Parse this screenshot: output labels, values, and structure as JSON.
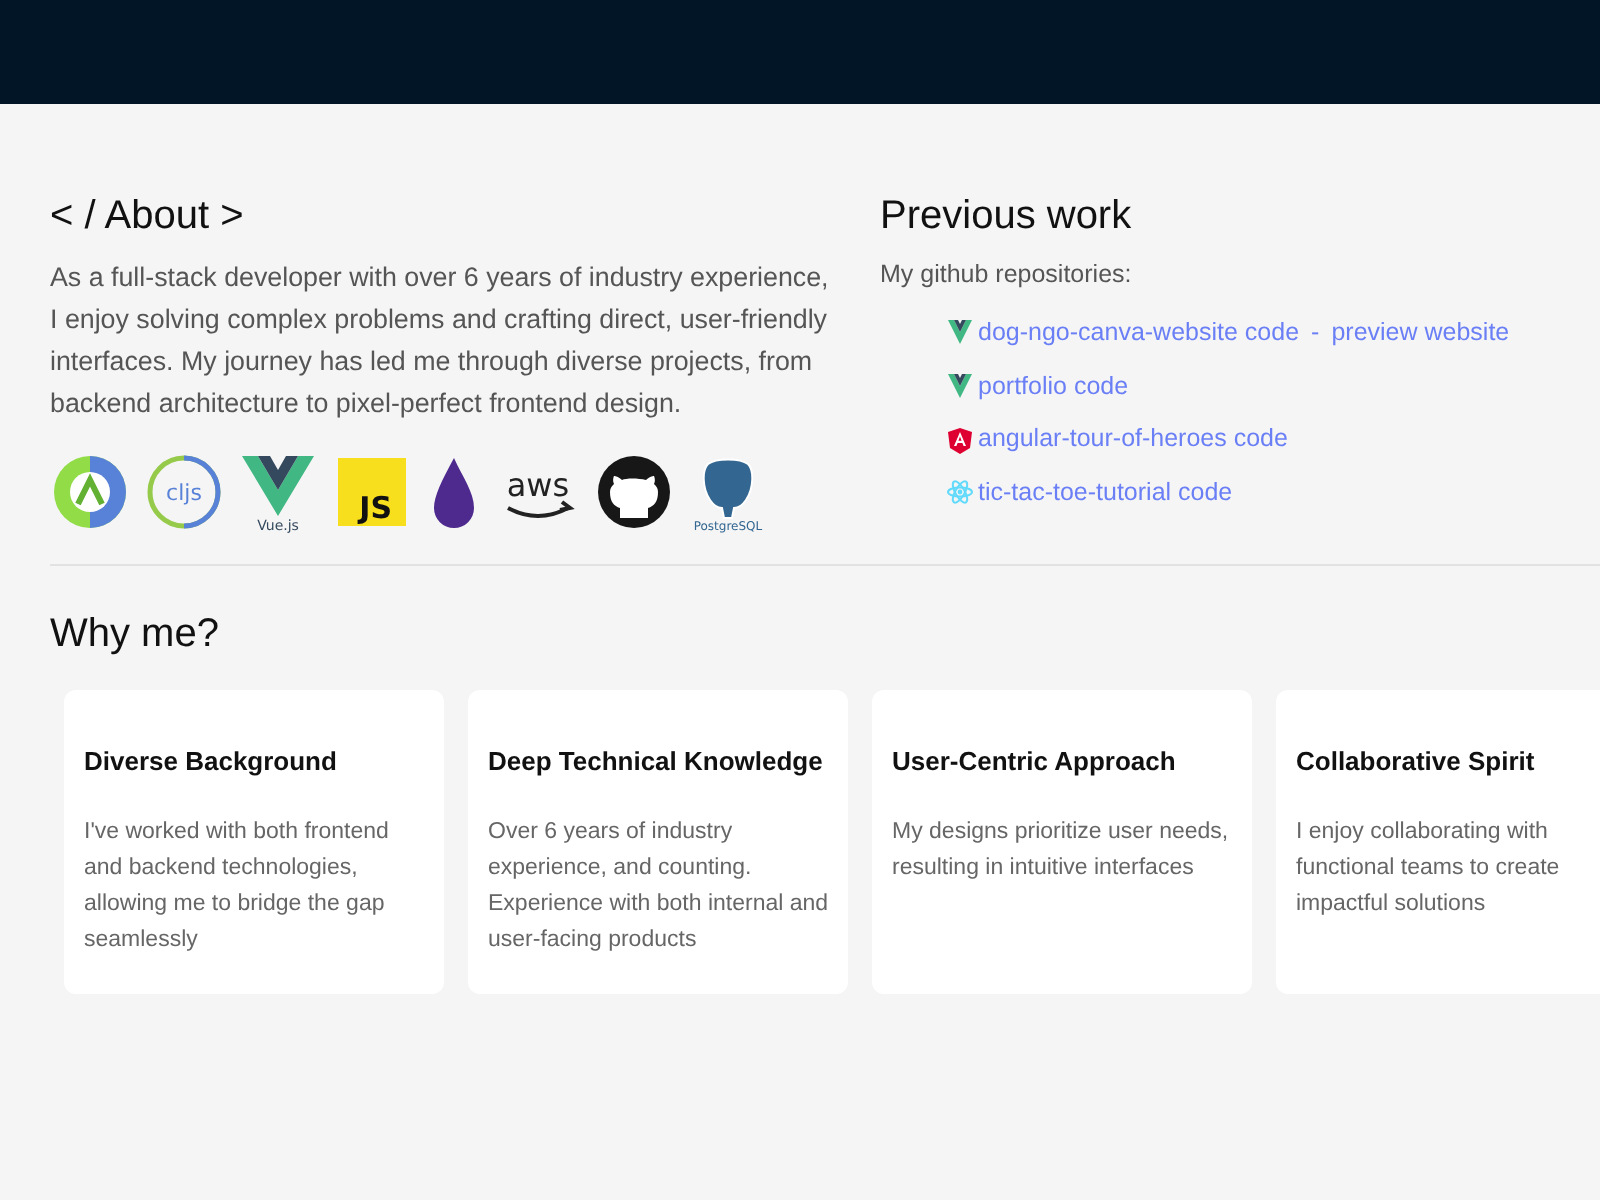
{
  "about": {
    "title": "< / About >",
    "text": "As a full-stack developer with over 6 years of industry experience, I enjoy solving complex problems and crafting direct, user-friendly interfaces. My journey has led me through diverse projects, from backend architecture to pixel-perfect frontend design.",
    "logos": [
      {
        "kind": "clojure"
      },
      {
        "kind": "cljs",
        "label": "cljs"
      },
      {
        "kind": "vue",
        "label": "Vue.js"
      },
      {
        "kind": "js",
        "label": "JS"
      },
      {
        "kind": "elixir"
      },
      {
        "kind": "aws",
        "label": "aws"
      },
      {
        "kind": "github"
      },
      {
        "kind": "postgres",
        "label": "PostgreSQL"
      }
    ]
  },
  "previous_work": {
    "title": "Previous work",
    "intro": "My github repositories:",
    "repos": [
      {
        "kind": "vue",
        "link": "dog-ngo-canva-website code",
        "separator": "-",
        "extra_link": "preview website"
      },
      {
        "kind": "vue",
        "link": "portfolio code"
      },
      {
        "kind": "angular",
        "link": "angular-tour-of-heroes code"
      },
      {
        "kind": "react",
        "link": "tic-tac-toe-tutorial code"
      }
    ]
  },
  "why_me": {
    "title": "Why me?",
    "cards": [
      {
        "title": "Diverse Background",
        "lines": [
          "I've worked with both frontend",
          "and backend technologies,",
          "allowing me to bridge the gap",
          "seamlessly"
        ]
      },
      {
        "title": "Deep Technical Knowledge",
        "lines": [
          "Over 6 years of industry",
          "experience, and counting.",
          "Experience with both internal and",
          "user-facing products"
        ]
      },
      {
        "title": "User-Centric Approach",
        "lines": [
          "My designs prioritize user needs,",
          "resulting in intuitive interfaces"
        ]
      },
      {
        "title": "Collaborative Spirit",
        "lines": [
          "I enjoy collaborating with",
          "functional teams to create",
          "impactful solutions"
        ]
      }
    ]
  }
}
